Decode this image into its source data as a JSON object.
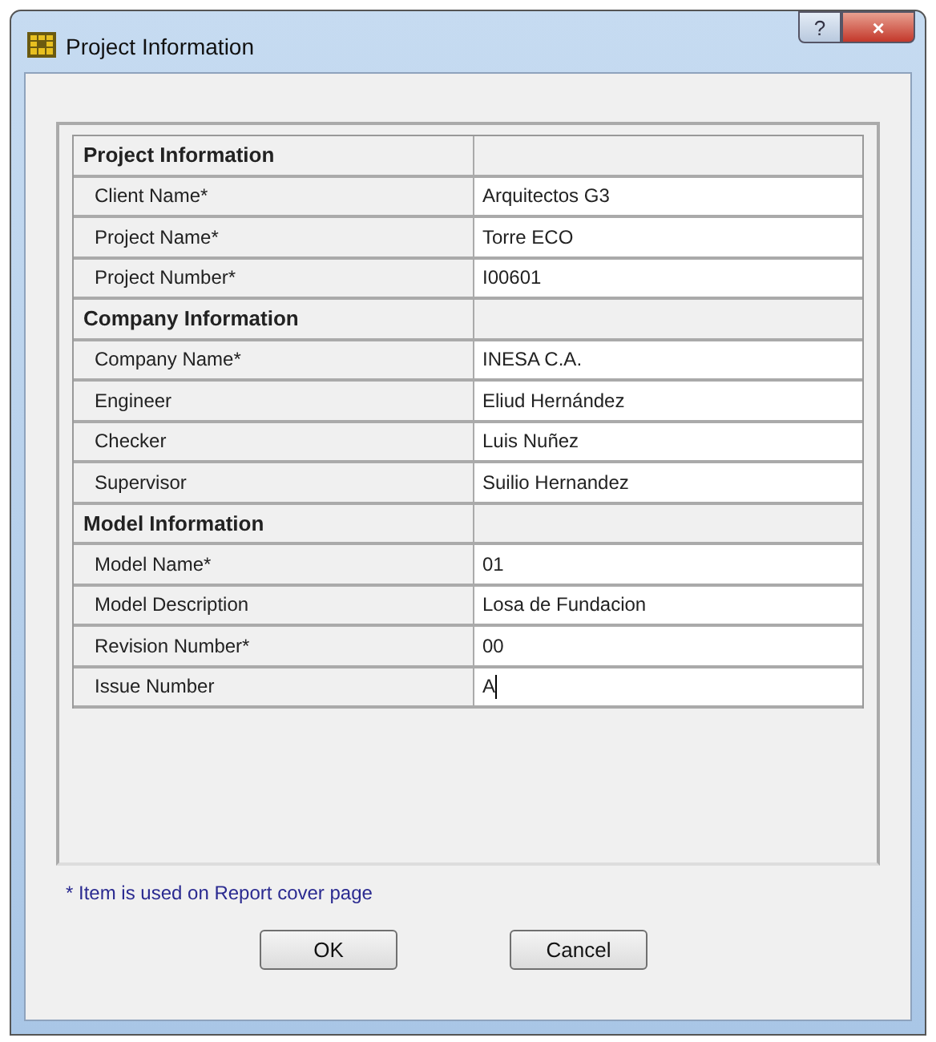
{
  "window": {
    "title": "Project Information",
    "buttons": [
      "?",
      "×"
    ]
  },
  "sections": [
    {
      "title": "Project Information",
      "rows": [
        {
          "label": "Client Name*",
          "value": "Arquitectos G3",
          "editing": false
        },
        {
          "label": "Project Name*",
          "value": "Torre ECO",
          "editing": false
        },
        {
          "label": "Project Number*",
          "value": "I00601",
          "editing": false
        }
      ]
    },
    {
      "title": "Company Information",
      "rows": [
        {
          "label": "Company Name*",
          "value": "INESA C.A.",
          "editing": false
        },
        {
          "label": "Engineer",
          "value": "Eliud Hernández",
          "editing": false
        },
        {
          "label": "Checker",
          "value": "Luis Nuñez",
          "editing": false
        },
        {
          "label": "Supervisor",
          "value": "Suilio Hernandez",
          "editing": false
        }
      ]
    },
    {
      "title": "Model Information",
      "rows": [
        {
          "label": "Model Name*",
          "value": "01",
          "editing": false
        },
        {
          "label": "Model Description",
          "value": "Losa de Fundacion",
          "editing": false
        },
        {
          "label": "Revision Number*",
          "value": "00",
          "editing": false
        },
        {
          "label": "Issue Number",
          "value": "A",
          "editing": true
        }
      ]
    }
  ],
  "footnote": "*  Item is used on Report cover page",
  "buttons": [
    "OK",
    "Cancel"
  ]
}
